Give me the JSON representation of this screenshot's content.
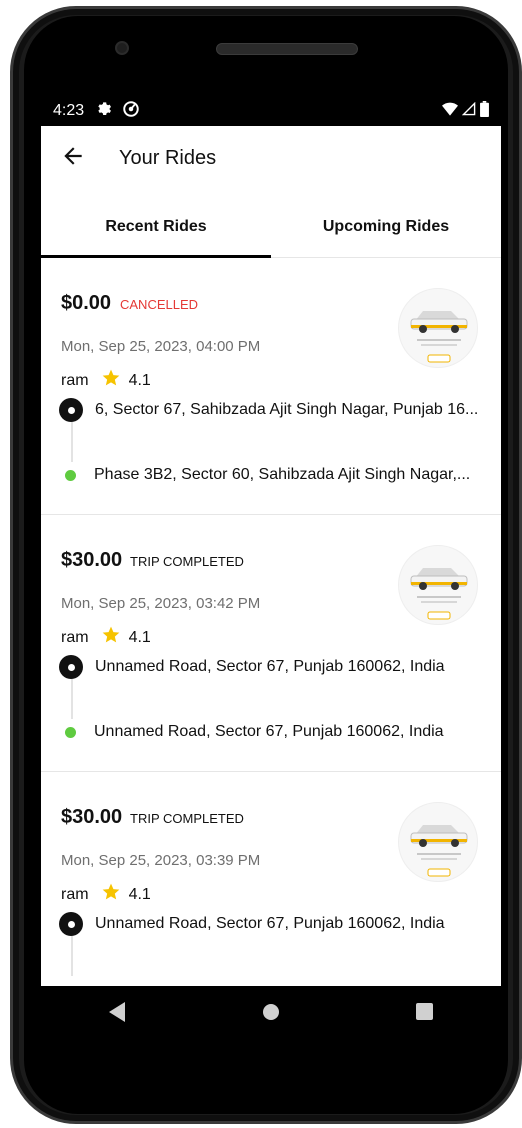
{
  "status_bar": {
    "time": "4:23"
  },
  "header": {
    "title": "Your Rides"
  },
  "tabs": [
    {
      "label": "Recent Rides",
      "active": true
    },
    {
      "label": "Upcoming Rides",
      "active": false
    }
  ],
  "rides": [
    {
      "price": "$0.00",
      "status": "CANCELLED",
      "date": "Mon, Sep 25, 2023, 04:00 PM",
      "driver": "ram",
      "rating": "4.1",
      "pickup": "6, Sector 67, Sahibzada Ajit Singh Nagar, Punjab 16...",
      "dropoff": "Phase 3B2, Sector 60, Sahibzada Ajit Singh Nagar,..."
    },
    {
      "price": "$30.00",
      "status": "TRIP COMPLETED",
      "date": "Mon, Sep 25, 2023, 03:42 PM",
      "driver": "ram",
      "rating": "4.1",
      "pickup": "Unnamed Road, Sector 67, Punjab 160062, India",
      "dropoff": "Unnamed Road, Sector 67, Punjab 160062, India"
    },
    {
      "price": "$30.00",
      "status": "TRIP COMPLETED",
      "date": "Mon, Sep 25, 2023, 03:39 PM",
      "driver": "ram",
      "rating": "4.1",
      "pickup": "Unnamed Road, Sector 67, Punjab 160062, India",
      "dropoff": ""
    }
  ],
  "colors": {
    "cancelled": "#e53935",
    "dropoff_dot": "#5fcb40",
    "star": "#f6c300",
    "accent": "#000000"
  }
}
